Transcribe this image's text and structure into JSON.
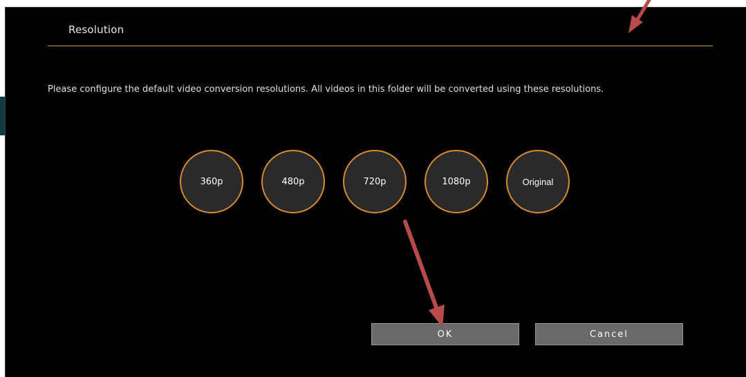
{
  "dialog": {
    "title": "Resolution",
    "description": "Please configure the default video conversion resolutions. All videos in this folder will be converted using these resolutions.",
    "resolutions": [
      {
        "label": "360p"
      },
      {
        "label": "480p"
      },
      {
        "label": "720p"
      },
      {
        "label": "1080p"
      },
      {
        "label": "Original"
      }
    ],
    "buttons": {
      "ok_label": "OK",
      "cancel_label": "Cancel"
    }
  },
  "colors": {
    "dialog_background": "#000000",
    "accent_orange": "#d88c2f",
    "title_rule": "#b8924a",
    "annotation_arrow": "#b84a4a",
    "button_gray": "#6a6a6a"
  },
  "annotations": [
    {
      "type": "arrow",
      "icon": "red-arrow-icon",
      "points_to": "top-right"
    },
    {
      "type": "arrow",
      "icon": "red-arrow-icon",
      "points_to": "ok-button"
    }
  ]
}
